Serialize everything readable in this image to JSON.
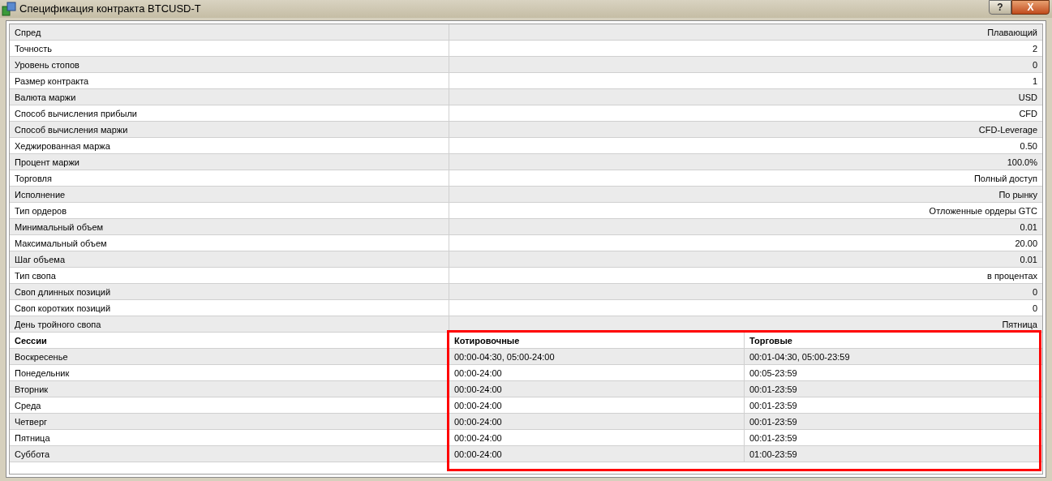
{
  "window": {
    "title": "Спецификация контракта BTCUSD-T",
    "buttons": [
      "?",
      "X"
    ]
  },
  "specs": [
    {
      "label": "Спред",
      "value": "Плавающий"
    },
    {
      "label": "Точность",
      "value": "2"
    },
    {
      "label": "Уровень стопов",
      "value": "0"
    },
    {
      "label": "Размер контракта",
      "value": "1"
    },
    {
      "label": "Валюта маржи",
      "value": "USD"
    },
    {
      "label": "Способ вычисления прибыли",
      "value": "CFD"
    },
    {
      "label": "Способ вычисления маржи",
      "value": "CFD-Leverage"
    },
    {
      "label": "Хеджированная маржа",
      "value": "0.50"
    },
    {
      "label": "Процент маржи",
      "value": "100.0%"
    },
    {
      "label": "Торговля",
      "value": "Полный доступ"
    },
    {
      "label": "Исполнение",
      "value": "По рынку"
    },
    {
      "label": "Тип ордеров",
      "value": "Отложенные ордеры GTC"
    },
    {
      "label": "Минимальный объем",
      "value": "0.01"
    },
    {
      "label": "Максимальный объем",
      "value": "20.00"
    },
    {
      "label": "Шаг объема",
      "value": "0.01"
    },
    {
      "label": "Тип свопа",
      "value": "в процентах"
    },
    {
      "label": "Своп длинных позиций",
      "value": "0"
    },
    {
      "label": "Своп коротких позиций",
      "value": "0"
    },
    {
      "label": "День тройного свопа",
      "value": "Пятница"
    }
  ],
  "sessions": {
    "highlighted": true,
    "columns": [
      "Сессии",
      "Котировочные",
      "Торговые"
    ],
    "rows": [
      {
        "day": "Воскресенье",
        "quote": "00:00-04:30, 05:00-24:00",
        "trade": "00:01-04:30, 05:00-23:59"
      },
      {
        "day": "Понедельник",
        "quote": "00:00-24:00",
        "trade": "00:05-23:59"
      },
      {
        "day": "Вторник",
        "quote": "00:00-24:00",
        "trade": "00:01-23:59"
      },
      {
        "day": "Среда",
        "quote": "00:00-24:00",
        "trade": "00:01-23:59"
      },
      {
        "day": "Четверг",
        "quote": "00:00-24:00",
        "trade": "00:01-23:59"
      },
      {
        "day": "Пятница",
        "quote": "00:00-24:00",
        "trade": "00:01-23:59"
      },
      {
        "day": "Суббота",
        "quote": "00:00-24:00",
        "trade": "01:00-23:59"
      }
    ]
  }
}
